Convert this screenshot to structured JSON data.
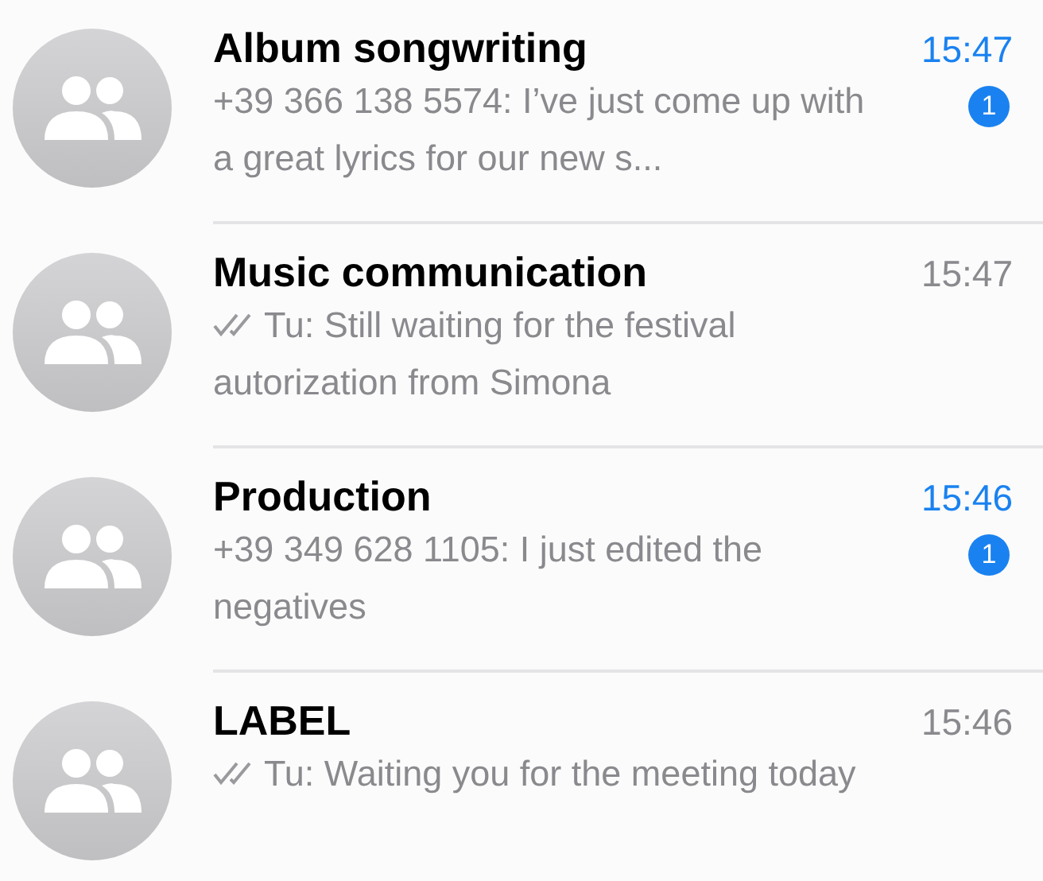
{
  "chats": [
    {
      "title": "Album songwriting",
      "time": "15:47",
      "unread": true,
      "badge": "1",
      "sent_by_me": false,
      "preview": "+39 366 138 5574: I’ve just come up with a great lyrics for our new s..."
    },
    {
      "title": "Music communication",
      "time": "15:47",
      "unread": false,
      "sent_by_me": true,
      "preview": "Tu: Still waiting for the festival autorization from Simona"
    },
    {
      "title": "Production",
      "time": "15:46",
      "unread": true,
      "badge": "1",
      "sent_by_me": false,
      "preview": "+39 349 628 1105: I just edited the negatives"
    },
    {
      "title": "LABEL",
      "time": "15:46",
      "unread": false,
      "sent_by_me": true,
      "preview": "Tu: Waiting you for the meeting today"
    }
  ]
}
